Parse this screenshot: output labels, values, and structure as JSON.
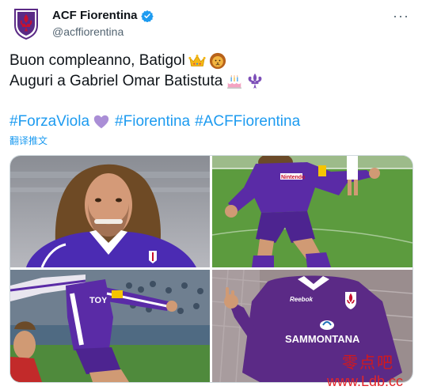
{
  "account": {
    "display_name": "ACF Fiorentina",
    "handle": "@acffiorentina",
    "verified": true,
    "avatar_icon": "fiorentina-crest-icon"
  },
  "menu": {
    "more_label": "···"
  },
  "tweet": {
    "line1": "Buon compleanno, Batigol",
    "line1_emojis": [
      "crown-icon",
      "lion-icon"
    ],
    "line2": "Auguri a Gabriel Omar Batistuta",
    "line2_emojis": [
      "birthday-cake-icon",
      "fleur-de-lis-icon"
    ],
    "hashtags": [
      "#ForzaViola",
      "#Fiorentina",
      "#ACFFiorentina"
    ],
    "hashtag_emoji": "purple-heart-icon",
    "translate_label": "翻译推文"
  },
  "media": {
    "photos": [
      {
        "name": "photo-portrait"
      },
      {
        "name": "photo-celebration-pitch"
      },
      {
        "name": "photo-machine-gun-celebration"
      },
      {
        "name": "photo-sammontana-shirt"
      }
    ],
    "shirt_texts": [
      "Nintendo",
      "SAMMONTANA",
      "Reebok",
      "TOY"
    ]
  },
  "watermark": {
    "chinese": "零点吧",
    "url": "www.Ldb.cc"
  },
  "colors": {
    "link": "#1d9bf0",
    "viola": "#5b2a86",
    "secondary_text": "#536471"
  }
}
